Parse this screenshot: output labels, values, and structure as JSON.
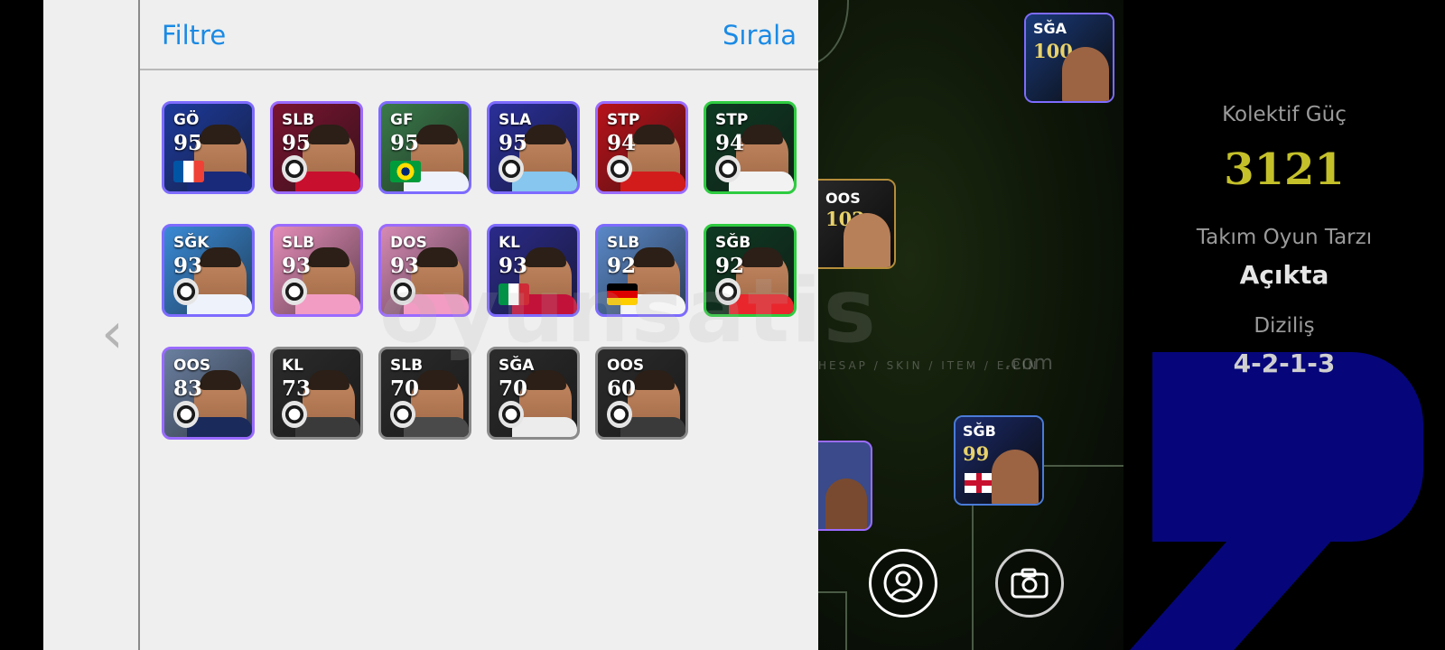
{
  "header": {
    "filter_label": "Filtre",
    "sort_label": "Sırala"
  },
  "nav": {
    "back_glyph": "‹"
  },
  "players": [
    {
      "pos": "GÖ",
      "rating": "95",
      "border": "#7d6bff",
      "bg": "#1d3a9c",
      "shirt": "#1a2a7a",
      "badge": "flag-france"
    },
    {
      "pos": "SLB",
      "rating": "95",
      "border": "#9a6bff",
      "bg": "#7a1430",
      "shirt": "#c8102e",
      "badge": "ac-milan-crest"
    },
    {
      "pos": "GF",
      "rating": "95",
      "border": "#7d6bff",
      "bg": "#3a7a4a",
      "shirt": "#eef2fb",
      "badge": "flag-brazil"
    },
    {
      "pos": "SLA",
      "rating": "95",
      "border": "#7d6bff",
      "bg": "#2a2f9a",
      "shirt": "#87c6ee",
      "badge": "lazio-crest"
    },
    {
      "pos": "STP",
      "rating": "94",
      "border": "#9a6bff",
      "bg": "#b8121a",
      "shirt": "#d21c1c",
      "badge": "man-utd-crest"
    },
    {
      "pos": "STP",
      "rating": "94",
      "border": "#2ecc40",
      "bg": "#0e3a22",
      "shirt": "#f2f2f2",
      "badge": "tottenham-crest"
    },
    {
      "pos": "SĞK",
      "rating": "93",
      "border": "#7d6bff",
      "bg": "#3a8ad6",
      "shirt": "#eef2fb",
      "badge": "club-crest"
    },
    {
      "pos": "SLB",
      "rating": "93",
      "border": "#9a6bff",
      "bg": "#e58db8",
      "shirt": "#f29cc3",
      "badge": "inter-miami-crest"
    },
    {
      "pos": "DOS",
      "rating": "93",
      "border": "#9a6bff",
      "bg": "#d68ab4",
      "shirt": "#f29cc3",
      "badge": "inter-miami-crest"
    },
    {
      "pos": "KL",
      "rating": "93",
      "border": "#7d6bff",
      "bg": "#2a2a8a",
      "shirt": "#c2123a",
      "badge": "flag-italy"
    },
    {
      "pos": "SLB",
      "rating": "92",
      "border": "#7d6bff",
      "bg": "#5a88c8",
      "shirt": "#f5f5f5",
      "badge": "flag-germany"
    },
    {
      "pos": "SĞB",
      "rating": "92",
      "border": "#2ecc40",
      "bg": "#0e3a22",
      "shirt": "#e8262c",
      "badge": "monaco-crest"
    },
    {
      "pos": "OOS",
      "rating": "83",
      "border": "#9a6bff",
      "bg": "#6a7fa0",
      "shirt": "#1a2a5a",
      "badge": "inter-crest"
    },
    {
      "pos": "KL",
      "rating": "73",
      "border": "#8a8a8a",
      "bg": "#2b2b2b",
      "shirt": "#3a3a3a",
      "badge": "al-ahli-crest"
    },
    {
      "pos": "SLB",
      "rating": "70",
      "border": "#8a8a8a",
      "bg": "#2b2b2b",
      "shirt": "#4a4a4a",
      "badge": "fenerbahce-crest"
    },
    {
      "pos": "SĞA",
      "rating": "70",
      "border": "#8a8a8a",
      "bg": "#2b2b2b",
      "shirt": "#ececec",
      "badge": "fenerbahce-crest"
    },
    {
      "pos": "OOS",
      "rating": "60",
      "border": "#8a8a8a",
      "bg": "#2b2b2b",
      "shirt": "#3a3a3a",
      "badge": "generic-crest"
    }
  ],
  "field_players": [
    {
      "pos": "SĞA",
      "rating": "100",
      "border": "#7d6bff",
      "bg": "#1a3a7a"
    },
    {
      "pos": "OOS",
      "rating": "102",
      "border": "#b58d3a",
      "bg": "#2a2a2a"
    },
    {
      "pos": "SĞB",
      "rating": "99",
      "border": "#4a7bd8",
      "bg": "#1a2a6a"
    }
  ],
  "team": {
    "power_label": "Kolektif Güç",
    "power_value": "3121",
    "power_color": "#c4c02a",
    "style_label": "Takım Oyun Tarzı",
    "style_value": "Açıkta",
    "formation_label": "Diziliş",
    "formation_value": "4-2-1-3"
  },
  "watermark": {
    "main": "oyunsatis",
    "sub": "HESAP / SKIN / ITEM / E-PIN",
    "tld": ".com"
  },
  "actions": {
    "profile_icon": "person-icon",
    "camera_icon": "camera-icon"
  }
}
